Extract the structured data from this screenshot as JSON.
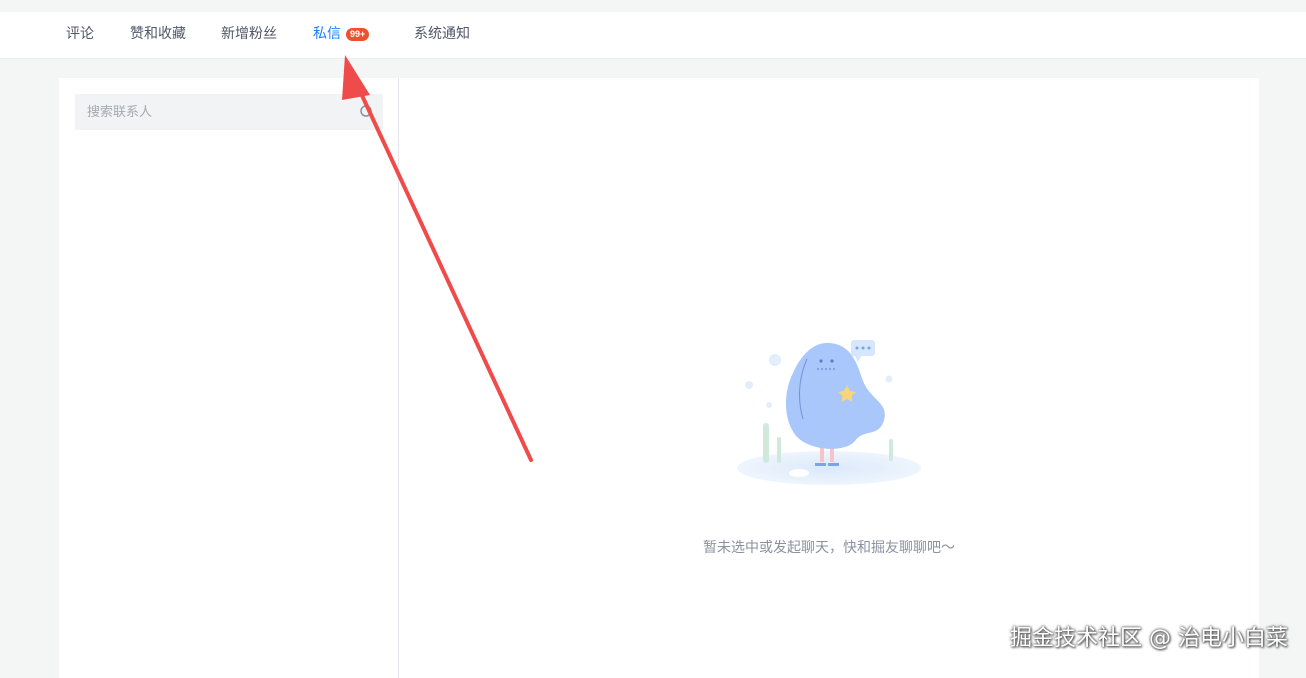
{
  "tabs": [
    {
      "label": "评论"
    },
    {
      "label": "赞和收藏"
    },
    {
      "label": "新增粉丝"
    },
    {
      "label": "私信",
      "badge": "99+",
      "active": true
    },
    {
      "label": "系统通知"
    }
  ],
  "contacts": {
    "search_placeholder": "搜索联系人",
    "search_icon": "search-icon"
  },
  "chat": {
    "empty_message": "暂未选中或发起聊天，快和掘友聊聊吧～",
    "illustration_icon": "ghost-chat-illustration"
  },
  "watermark": "掘金技术社区 @ 治电小白菜",
  "colors": {
    "active_tab": "#1e80ff",
    "badge": "#ee502f",
    "arrow": "#ef4b4b"
  }
}
